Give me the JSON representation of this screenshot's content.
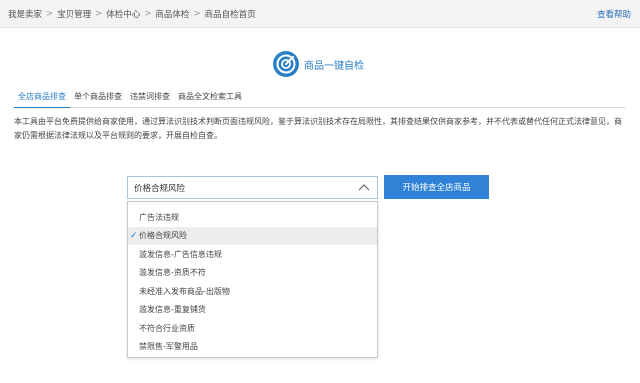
{
  "breadcrumb": {
    "items": [
      "我是卖家",
      "宝贝管理",
      "体检中心",
      "商品体检",
      "商品自检首页"
    ],
    "separator": ">"
  },
  "help_link": "查看帮助",
  "hero": {
    "title": "商品一键自检",
    "icon": "target-check-icon"
  },
  "tabs": [
    {
      "label": "全店商品排查",
      "active": true
    },
    {
      "label": "单个商品排查",
      "active": false
    },
    {
      "label": "违禁词排查",
      "active": false
    },
    {
      "label": "商品全文检索工具",
      "active": false
    }
  ],
  "description": "本工具由平台免费提供给商家使用，通过算法识别技术判断页面违规风险，鉴于算法识别技术存在局限性，其排查结果仅供商家参考，并不代表或替代任何正式法律意见，商家仍需根据法律法规以及平台规则的要求，开展自检自查。",
  "select": {
    "value": "价格合规风险",
    "expanded": true,
    "options": [
      {
        "label": "广告法违规",
        "selected": false
      },
      {
        "label": "价格合规风险",
        "selected": true
      },
      {
        "label": "滥发信息-广告信息违规",
        "selected": false
      },
      {
        "label": "滥发信息-资质不符",
        "selected": false
      },
      {
        "label": "未经准入发布商品-出版物",
        "selected": false
      },
      {
        "label": "滥发信息-重复铺货",
        "selected": false
      },
      {
        "label": "不符合行业资质",
        "selected": false
      },
      {
        "label": "禁限售-军警用品",
        "selected": false
      }
    ]
  },
  "start_button": "开始排查全店商品",
  "colors": {
    "accent": "#2a7fc8",
    "button": "#2f82d6",
    "topbar": "#f3f3f3"
  }
}
